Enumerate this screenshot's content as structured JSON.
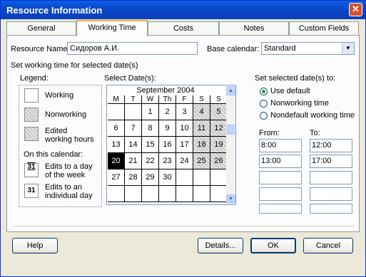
{
  "window": {
    "title": "Resource Information",
    "close_glyph": "✕"
  },
  "tabs": [
    {
      "label": "General"
    },
    {
      "label": "Working Time",
      "active": true
    },
    {
      "label": "Costs"
    },
    {
      "label": "Notes"
    },
    {
      "label": "Custom Fields"
    }
  ],
  "resource": {
    "name_label": "Resource Name:",
    "name_value": "Сидоров А.И.",
    "base_calendar_label": "Base calendar:",
    "base_calendar_value": "Standard"
  },
  "section_label": "Set working time for selected date(s)",
  "legend": {
    "title": "Legend:",
    "items": [
      {
        "label": "Working"
      },
      {
        "label": "Nonworking"
      },
      {
        "label": "Edited working hours"
      }
    ],
    "on_calendar_label": "On this calendar:",
    "edits_day_week": {
      "icon": "31",
      "label": "Edits to a day of the week"
    },
    "edits_individual": {
      "icon": "31",
      "label": "Edits to an individual day"
    }
  },
  "calendar": {
    "select_label": "Select Date(s):",
    "month": "September 2004",
    "weekdays": [
      "M",
      "T",
      "W",
      "Th",
      "F",
      "S",
      "S"
    ],
    "weeks": [
      [
        "",
        "",
        "1",
        "2",
        "3",
        "4",
        "5"
      ],
      [
        "6",
        "7",
        "8",
        "9",
        "10",
        "11",
        "12"
      ],
      [
        "13",
        "14",
        "15",
        "16",
        "17",
        "18",
        "19"
      ],
      [
        "20",
        "21",
        "22",
        "23",
        "24",
        "25",
        "26"
      ],
      [
        "27",
        "28",
        "29",
        "30",
        "",
        "",
        ""
      ],
      [
        "",
        "",
        "",
        "",
        "",
        "",
        ""
      ]
    ],
    "selected_day": "20"
  },
  "set_dates": {
    "label": "Set selected date(s) to:",
    "options": [
      {
        "label": "Use default",
        "checked": true
      },
      {
        "label": "Nonworking time",
        "checked": false
      },
      {
        "label": "Nondefault working time",
        "checked": false
      }
    ],
    "from_label": "From:",
    "to_label": "To:",
    "rows": [
      {
        "from": "8:00",
        "to": "12:00"
      },
      {
        "from": "13:00",
        "to": "17:00"
      },
      {
        "from": "",
        "to": ""
      },
      {
        "from": "",
        "to": ""
      },
      {
        "from": "",
        "to": ""
      }
    ]
  },
  "buttons": {
    "help": "Help",
    "details": "Details...",
    "ok": "OK",
    "cancel": "Cancel"
  }
}
